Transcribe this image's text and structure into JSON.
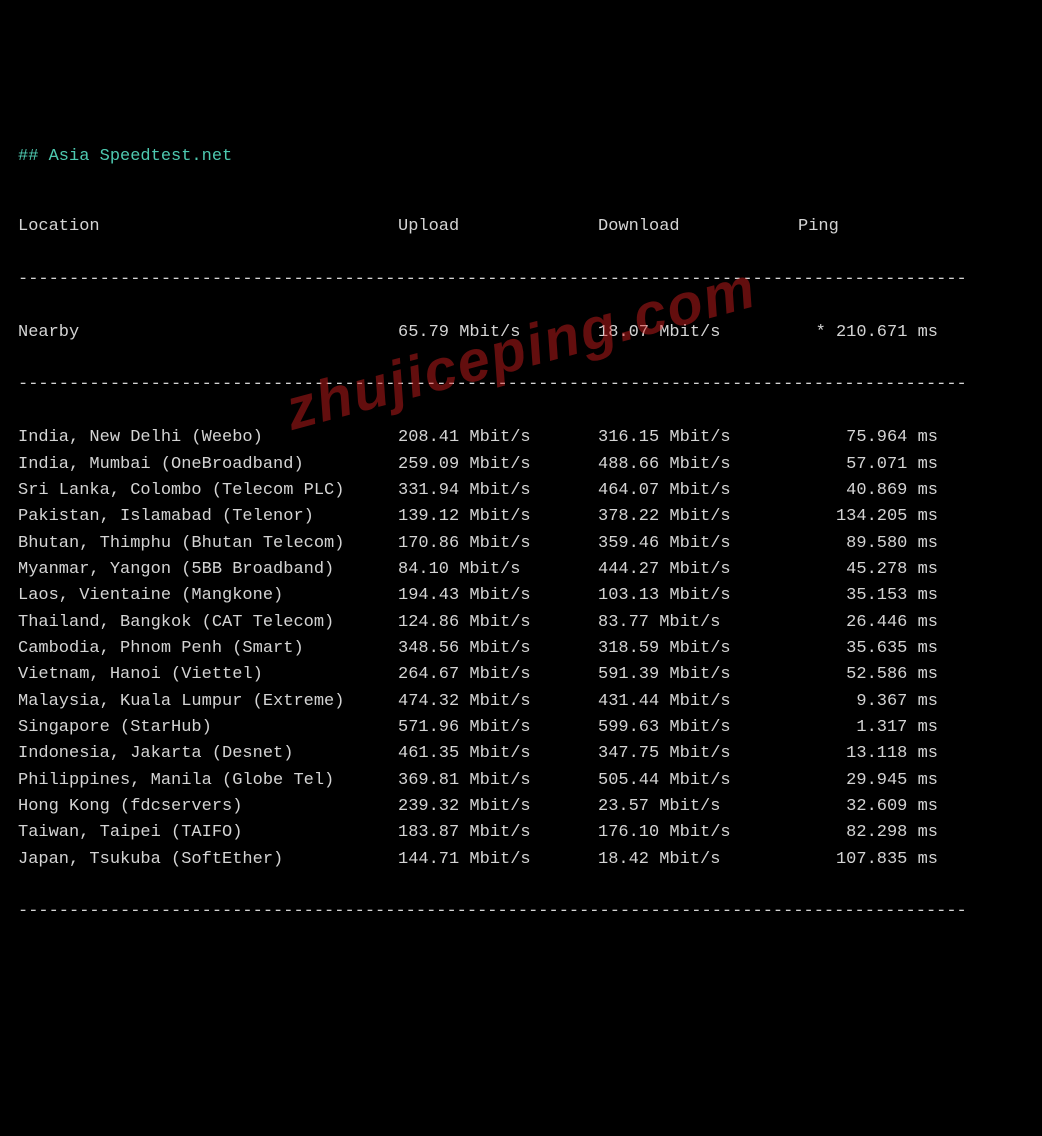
{
  "title": "## Asia Speedtest.net",
  "headers": {
    "location": "Location",
    "upload": "Upload",
    "download": "Download",
    "ping": "Ping"
  },
  "divider": "---------------------------------------------------------------------------------------------",
  "nearby": {
    "location": "Nearby",
    "upload": "65.79 Mbit/s",
    "download": "18.07 Mbit/s",
    "ping": "* 210.671 ms"
  },
  "rows": [
    {
      "location": "India, New Delhi (Weebo)",
      "upload": "208.41 Mbit/s",
      "download": "316.15 Mbit/s",
      "ping": "75.964 ms"
    },
    {
      "location": "India, Mumbai (OneBroadband)",
      "upload": "259.09 Mbit/s",
      "download": "488.66 Mbit/s",
      "ping": "57.071 ms"
    },
    {
      "location": "Sri Lanka, Colombo (Telecom PLC)",
      "upload": "331.94 Mbit/s",
      "download": "464.07 Mbit/s",
      "ping": "40.869 ms"
    },
    {
      "location": "Pakistan, Islamabad (Telenor)",
      "upload": "139.12 Mbit/s",
      "download": "378.22 Mbit/s",
      "ping": "134.205 ms"
    },
    {
      "location": "Bhutan, Thimphu (Bhutan Telecom)",
      "upload": "170.86 Mbit/s",
      "download": "359.46 Mbit/s",
      "ping": "89.580 ms"
    },
    {
      "location": "Myanmar, Yangon (5BB Broadband)",
      "upload": "84.10 Mbit/s",
      "download": "444.27 Mbit/s",
      "ping": "45.278 ms"
    },
    {
      "location": "Laos, Vientaine (Mangkone)",
      "upload": "194.43 Mbit/s",
      "download": "103.13 Mbit/s",
      "ping": "35.153 ms"
    },
    {
      "location": "Thailand, Bangkok (CAT Telecom)",
      "upload": "124.86 Mbit/s",
      "download": "83.77 Mbit/s",
      "ping": "26.446 ms"
    },
    {
      "location": "Cambodia, Phnom Penh (Smart)",
      "upload": "348.56 Mbit/s",
      "download": "318.59 Mbit/s",
      "ping": "35.635 ms"
    },
    {
      "location": "Vietnam, Hanoi (Viettel)",
      "upload": "264.67 Mbit/s",
      "download": "591.39 Mbit/s",
      "ping": "52.586 ms"
    },
    {
      "location": "Malaysia, Kuala Lumpur (Extreme)",
      "upload": "474.32 Mbit/s",
      "download": "431.44 Mbit/s",
      "ping": "9.367 ms"
    },
    {
      "location": "Singapore (StarHub)",
      "upload": "571.96 Mbit/s",
      "download": "599.63 Mbit/s",
      "ping": "1.317 ms"
    },
    {
      "location": "Indonesia, Jakarta (Desnet)",
      "upload": "461.35 Mbit/s",
      "download": "347.75 Mbit/s",
      "ping": "13.118 ms"
    },
    {
      "location": "Philippines, Manila (Globe Tel)",
      "upload": "369.81 Mbit/s",
      "download": "505.44 Mbit/s",
      "ping": "29.945 ms"
    },
    {
      "location": "Hong Kong (fdcservers)",
      "upload": "239.32 Mbit/s",
      "download": "23.57 Mbit/s",
      "ping": "32.609 ms"
    },
    {
      "location": "Taiwan, Taipei (TAIFO)",
      "upload": "183.87 Mbit/s",
      "download": "176.10 Mbit/s",
      "ping": "82.298 ms"
    },
    {
      "location": "Japan, Tsukuba (SoftEther)",
      "upload": "144.71 Mbit/s",
      "download": "18.42 Mbit/s",
      "ping": "107.835 ms"
    }
  ],
  "watermark": "zhujiceping.com"
}
